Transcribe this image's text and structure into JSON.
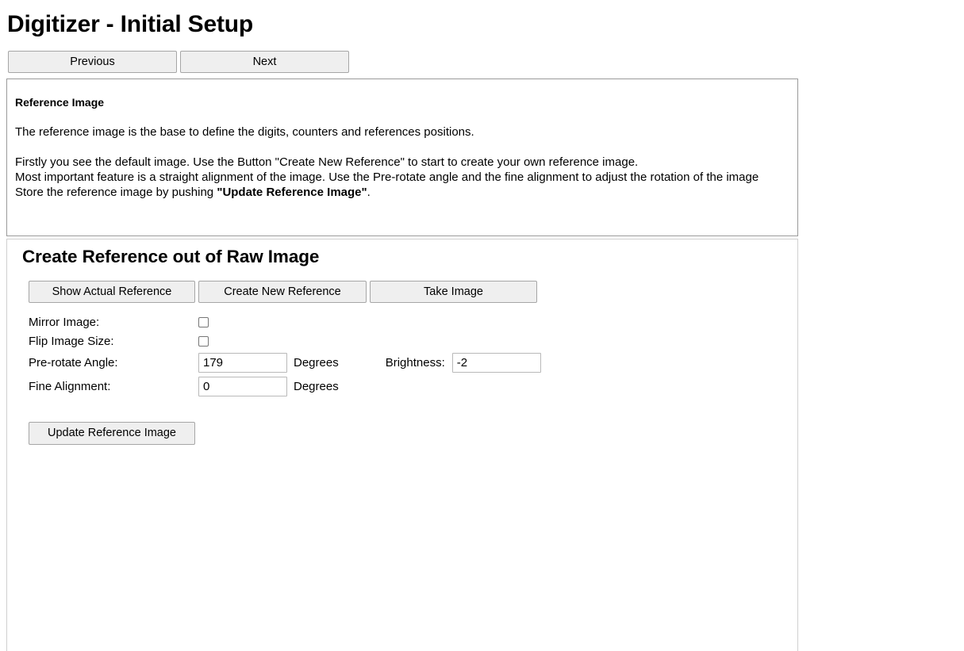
{
  "page": {
    "title": "Digitizer - Initial Setup"
  },
  "nav": {
    "previous_label": "Previous",
    "next_label": "Next"
  },
  "info_panel": {
    "heading": "Reference Image",
    "paragraph1": "The reference image is the base to define the digits, counters and references positions.",
    "line1": "Firstly you see the default image. Use the Button \"Create New Reference\" to start to create your own reference image.",
    "line2": "Most important feature is a straight alignment of the image. Use the Pre-rotate angle and the fine alignment to adjust the rotation of the image",
    "line3_prefix": "Store the reference image by pushing ",
    "line3_bold": "\"Update Reference Image\"",
    "line3_suffix": "."
  },
  "form": {
    "heading": "Create Reference out of Raw Image",
    "buttons": {
      "show_actual_reference": "Show Actual Reference",
      "create_new_reference": "Create New Reference",
      "take_image": "Take Image",
      "update_reference_image": "Update Reference Image"
    },
    "fields": {
      "mirror_image_label": "Mirror Image:",
      "mirror_image_checked": false,
      "flip_image_size_label": "Flip Image Size:",
      "flip_image_size_checked": false,
      "pre_rotate_angle_label": "Pre-rotate Angle:",
      "pre_rotate_angle_value": "179",
      "pre_rotate_angle_unit": "Degrees",
      "fine_alignment_label": "Fine Alignment:",
      "fine_alignment_value": "0",
      "fine_alignment_unit": "Degrees",
      "brightness_label": "Brightness:",
      "brightness_value": "-2"
    }
  },
  "colors": {
    "button_face": "#efefef",
    "button_border": "#a6a6a6",
    "panel_border_strong": "#9a9a9a",
    "panel_border_light": "#d0d0d0",
    "input_border": "#b9b9b9",
    "text": "#000000"
  }
}
